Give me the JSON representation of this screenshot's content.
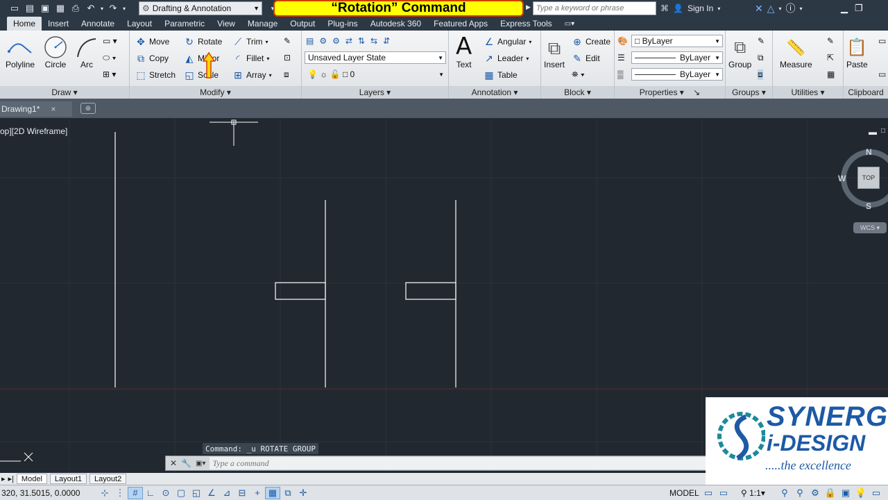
{
  "app": {
    "workspace": "Drafting & Annotation",
    "banner": "“Rotation” Command",
    "search_placeholder": "Type a keyword or phrase",
    "sign_in": "Sign In"
  },
  "tabs": [
    "Home",
    "Insert",
    "Annotate",
    "Layout",
    "Parametric",
    "View",
    "Manage",
    "Output",
    "Plug-ins",
    "Autodesk 360",
    "Featured Apps",
    "Express Tools"
  ],
  "ribbon": {
    "draw": {
      "title": "Draw",
      "polyline": "Polyline",
      "circle": "Circle",
      "arc": "Arc"
    },
    "modify": {
      "title": "Modify",
      "move": "Move",
      "rotate": "Rotate",
      "trim": "Trim",
      "copy": "Copy",
      "mirror": "Mirror",
      "fillet": "Fillet",
      "stretch": "Stretch",
      "scale": "Scale",
      "array": "Array"
    },
    "layers": {
      "title": "Layers",
      "state": "Unsaved Layer State",
      "current": "0"
    },
    "annotation": {
      "title": "Annotation",
      "text": "Text",
      "angular": "Angular",
      "leader": "Leader",
      "table": "Table"
    },
    "block": {
      "title": "Block",
      "insert": "Insert",
      "create": "Create",
      "edit": "Edit"
    },
    "properties": {
      "title": "Properties",
      "color": "ByLayer",
      "linetype": "ByLayer",
      "lineweight": "ByLayer"
    },
    "groups": {
      "title": "Groups",
      "group": "Group"
    },
    "utilities": {
      "title": "Utilities",
      "measure": "Measure"
    },
    "clipboard": {
      "title": "Clipboard",
      "paste": "Paste"
    }
  },
  "file_tab": "Drawing1*",
  "viewport_label": "op][2D Wireframe]",
  "viewcube": {
    "n": "N",
    "s": "S",
    "w": "W",
    "top": "TOP",
    "wcs": "WCS"
  },
  "command": {
    "history": "Command: _u ROTATE GROUP",
    "placeholder": "Type a command"
  },
  "layout_tabs": [
    "Model",
    "Layout1",
    "Layout2"
  ],
  "status": {
    "coords": "320, 31.5015, 0.0000",
    "model": "MODEL",
    "scale": "1:1"
  },
  "logo": {
    "line1": "SYNERGY",
    "line2": "i-DESIGN",
    "line3": ".....the excellence"
  }
}
